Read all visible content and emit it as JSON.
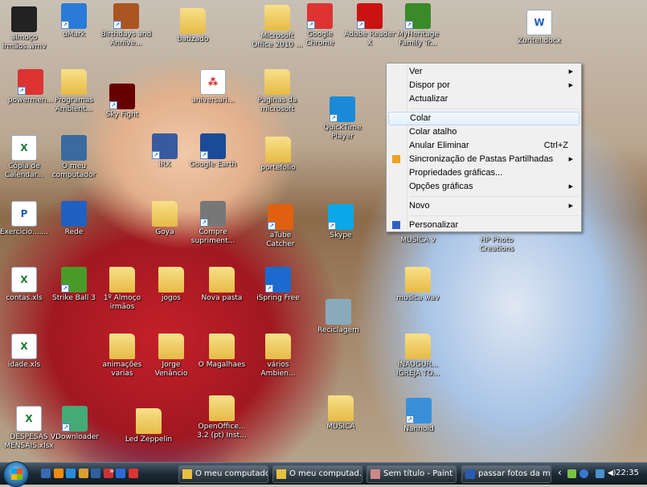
{
  "desktop": {
    "icons": [
      {
        "label": "almoço irmãos.wmv",
        "kind": "video",
        "icon": "video-file-icon"
      },
      {
        "label": "uMark",
        "kind": "app",
        "icon": "umark-icon",
        "shortcut": true
      },
      {
        "label": "Birthdays and Annive...",
        "kind": "app",
        "icon": "birthdays-icon",
        "shortcut": true
      },
      {
        "label": "batizado",
        "kind": "folder",
        "icon": "folder-icon"
      },
      {
        "label": "Microsoft Office 2010 ...",
        "kind": "folder",
        "icon": "folder-icon"
      },
      {
        "label": "Google Chrome",
        "kind": "app",
        "icon": "chrome-icon",
        "shortcut": true
      },
      {
        "label": "Adobe Reader X",
        "kind": "app",
        "icon": "adobe-reader-icon",
        "shortcut": true
      },
      {
        "label": "MyHeritage Family Tr...",
        "kind": "app",
        "icon": "myheritage-icon",
        "shortcut": true
      },
      {
        "label": "Zuritel.docx",
        "kind": "doc",
        "icon": "word-document-icon"
      },
      {
        "label": "powermen...",
        "kind": "app",
        "icon": "chrome-icon",
        "shortcut": true
      },
      {
        "label": "Programas Ambient...",
        "kind": "folder",
        "icon": "folder-icon"
      },
      {
        "label": "Sky Fight",
        "kind": "app",
        "icon": "sky-fight-icon",
        "shortcut": true
      },
      {
        "label": "aniversari...",
        "kind": "doc",
        "icon": "pdf-document-icon"
      },
      {
        "label": "Paginas da microsoft",
        "kind": "folder",
        "icon": "folder-icon"
      },
      {
        "label": "QuickTime Player",
        "kind": "app",
        "icon": "quicktime-icon",
        "shortcut": true
      },
      {
        "label": "Cópia de Calendar...",
        "kind": "xls",
        "icon": "excel-file-icon"
      },
      {
        "label": "O meu computador",
        "kind": "app",
        "icon": "computer-icon"
      },
      {
        "label": "iRX",
        "kind": "app",
        "icon": "irx-icon",
        "shortcut": true
      },
      {
        "label": "Google Earth",
        "kind": "app",
        "icon": "google-earth-icon",
        "shortcut": true
      },
      {
        "label": "portefolio",
        "kind": "folder",
        "icon": "folder-icon"
      },
      {
        "label": "Exercicio.......",
        "kind": "doc",
        "icon": "powerpoint-file-icon"
      },
      {
        "label": "Rede",
        "kind": "app",
        "icon": "network-icon"
      },
      {
        "label": "Goya",
        "kind": "folder",
        "icon": "folder-icon"
      },
      {
        "label": "Compre supriment...",
        "kind": "app",
        "icon": "printer-icon",
        "shortcut": true
      },
      {
        "label": "aTube Catcher",
        "kind": "app",
        "icon": "atube-catcher-icon",
        "shortcut": true
      },
      {
        "label": "Skype",
        "kind": "app",
        "icon": "skype-icon",
        "shortcut": true
      },
      {
        "label": "MUSICA v",
        "kind": "none",
        "icon": "folder-icon"
      },
      {
        "label": "HP Photo Creations",
        "kind": "none",
        "icon": "hp-photo-icon"
      },
      {
        "label": "contas.xls",
        "kind": "xls",
        "icon": "excel-file-icon"
      },
      {
        "label": "Strike Ball 3",
        "kind": "app",
        "icon": "strike-ball-icon",
        "shortcut": true
      },
      {
        "label": "1º Almoço irmãos",
        "kind": "folder",
        "icon": "folder-icon"
      },
      {
        "label": "jogos",
        "kind": "folder",
        "icon": "folder-icon"
      },
      {
        "label": "Nova pasta",
        "kind": "folder",
        "icon": "folder-icon"
      },
      {
        "label": "iSpring Free",
        "kind": "app",
        "icon": "ispring-icon",
        "shortcut": true
      },
      {
        "label": "Reciclagem",
        "kind": "app",
        "icon": "recycle-bin-icon"
      },
      {
        "label": "musica wav",
        "kind": "folder",
        "icon": "folder-icon"
      },
      {
        "label": "idade.xls",
        "kind": "xls",
        "icon": "excel-file-icon"
      },
      {
        "label": "animações varias",
        "kind": "folder",
        "icon": "folder-icon"
      },
      {
        "label": "Jorge Venâncio",
        "kind": "folder",
        "icon": "folder-icon"
      },
      {
        "label": "O Magalhaes",
        "kind": "folder",
        "icon": "folder-icon"
      },
      {
        "label": "vários Ambien...",
        "kind": "folder",
        "icon": "folder-icon"
      },
      {
        "label": "INAUGUR... IGREJA TO...",
        "kind": "folder",
        "icon": "folder-icon"
      },
      {
        "label": "DESPESAS MENSAIS.xlsx",
        "kind": "xls",
        "icon": "excel-file-icon"
      },
      {
        "label": "VDownloader",
        "kind": "app",
        "icon": "vdownloader-icon",
        "shortcut": true
      },
      {
        "label": "Led Zeppelin",
        "kind": "folder",
        "icon": "folder-icon"
      },
      {
        "label": "OpenOffice... 3.2 (pt) Inst...",
        "kind": "folder",
        "icon": "folder-icon"
      },
      {
        "label": "MUSICA",
        "kind": "folder",
        "icon": "folder-icon"
      },
      {
        "label": "Nannoid",
        "kind": "app",
        "icon": "nannoid-icon",
        "shortcut": true
      }
    ]
  },
  "context_menu": {
    "items": [
      {
        "label": "Ver",
        "submenu": true
      },
      {
        "label": "Dispor por",
        "submenu": true
      },
      {
        "label": "Actualizar"
      },
      {
        "label": "Colar",
        "highlighted": true
      },
      {
        "label": "Colar atalho"
      },
      {
        "label": "Anular Eliminar",
        "shortcut": "Ctrl+Z"
      },
      {
        "label": "Sincronização de Pastas Partilhadas",
        "submenu": true,
        "icon": "sync-icon"
      },
      {
        "label": "Propriedades gráficas..."
      },
      {
        "label": "Opções gráficas",
        "submenu": true
      },
      {
        "label": "Novo",
        "submenu": true
      },
      {
        "label": "Personalizar",
        "icon": "personalize-icon"
      }
    ]
  },
  "taskbar": {
    "quick_launch": [
      "show-desktop-icon",
      "media-player-icon",
      "internet-explorer-icon",
      "user-icon",
      "switch-windows-icon",
      "recorder-icon",
      "media-icon",
      "chrome-icon"
    ],
    "overflow": "»",
    "buttons": [
      {
        "label": "O meu computador",
        "icon": "folder-icon"
      },
      {
        "label": "O meu computad...",
        "icon": "folder-icon"
      },
      {
        "label": "Sem título - Paint",
        "icon": "paint-icon"
      },
      {
        "label": "passar fotos da m...",
        "icon": "word-icon"
      }
    ],
    "tray_expand": "‹",
    "clock": "22:35"
  }
}
